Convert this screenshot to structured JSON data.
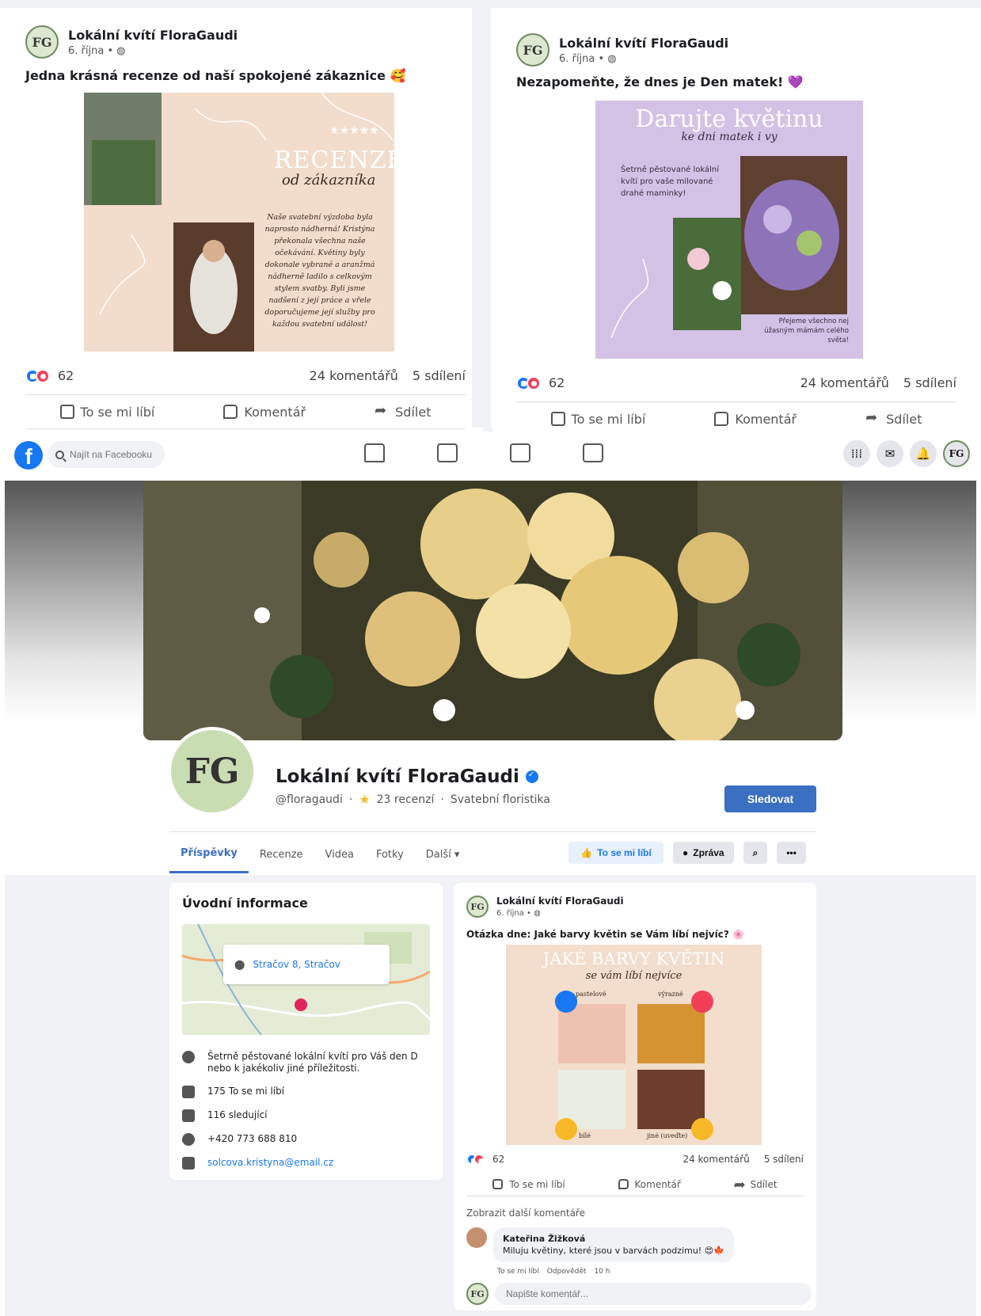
{
  "colors": {
    "brand": "#1877f2",
    "follow": "#3b6fc2",
    "bg": "#f0f2f5"
  },
  "posts_top": [
    {
      "author": "Lokální kvítí FloraGaudi",
      "date": "6. října • ",
      "text": "Jedna krásná recenze od naší spokojené zákaznice 🥰",
      "image": {
        "title": "RECENZE",
        "subtitle": "od zákazníka",
        "stars": "★★★★★",
        "quote": "Naše svatební výzdoba byla naprosto nádherná! Kristýna překonala všechna naše očekávání. Květiny byly dokonale vybrané a aranžmá nádherně ladilo s celkovým stylem svatby. Byli jsme nadšení z její práce a vřele doporučujeme její služby pro každou svatební událost!"
      },
      "reactions": "62",
      "comments": "24 komentářů",
      "shares": "5 sdílení",
      "actions": [
        "To se mi líbí",
        "Komentář",
        "Sdílet"
      ]
    },
    {
      "author": "Lokální kvítí FloraGaudi",
      "date": "6. října • ",
      "text": "Nezapomeňte, že dnes je Den matek! 💜",
      "image": {
        "title": "Darujte květinu",
        "subtitle": "ke dni matek i vy",
        "body": "Šetrně pěstované lokální kvítí pro vaše milované drahé maminky!",
        "footer": "Přejeme všechno nej úžasným mámám celého světa!"
      },
      "reactions": "62",
      "comments": "24 komentářů",
      "shares": "5 sdílení",
      "actions": [
        "To se mi líbí",
        "Komentář",
        "Sdílet"
      ]
    }
  ],
  "nav": {
    "search_placeholder": "Najít na Facebooku",
    "logo": "f",
    "avatar": "FG"
  },
  "page": {
    "name": "Lokální kvítí FloraGaudi",
    "handle": "@floragaudi",
    "rating": "23 recenzí",
    "category": "Svatební floristika",
    "follow": "Sledovat",
    "avatar": "FG"
  },
  "tabs": [
    "Příspěvky",
    "Recenze",
    "Videa",
    "Fotky",
    "Další ▾"
  ],
  "tab_buttons": {
    "like": "To se mi líbí",
    "message": "Zpráva"
  },
  "intro": {
    "title": "Úvodní informace",
    "address": "Stračov 8, Stračov",
    "description": "Šetrně pěstované lokální kvítí pro Váš den D nebo k jakékoliv jiné příležitosti.",
    "likes": "175 To se mi líbí",
    "followers": "116 sledující",
    "phone": "+420 773 688 810",
    "email": "solcova.kristyna@email.cz"
  },
  "feed_post": {
    "author": "Lokální kvítí FloraGaudi",
    "date": "6. října • ",
    "text": "Otázka dne: Jaké barvy květin se Vám líbí nejvíc? 🌸",
    "image": {
      "title": "JAKÉ BARVY KVĚTIN",
      "subtitle": "se vám líbí nejvíce",
      "labels": [
        "pastelové",
        "výrazné",
        "bílé",
        "jiné (uveďte)"
      ]
    },
    "reactions": "62",
    "comments": "24 komentářů",
    "shares": "5 sdílení",
    "actions": [
      "To se mi líbí",
      "Komentář",
      "Sdílet"
    ],
    "more_comments": "Zobrazit další komentáře",
    "comment": {
      "author": "Kateřina Žižková",
      "text": "Miluju květiny, které jsou v barvách podzimu! 😍🍁",
      "like": "To se mi líbí",
      "reply": "Odpovědět",
      "time": "10 h"
    },
    "comment_placeholder": "Napište komentář..."
  }
}
